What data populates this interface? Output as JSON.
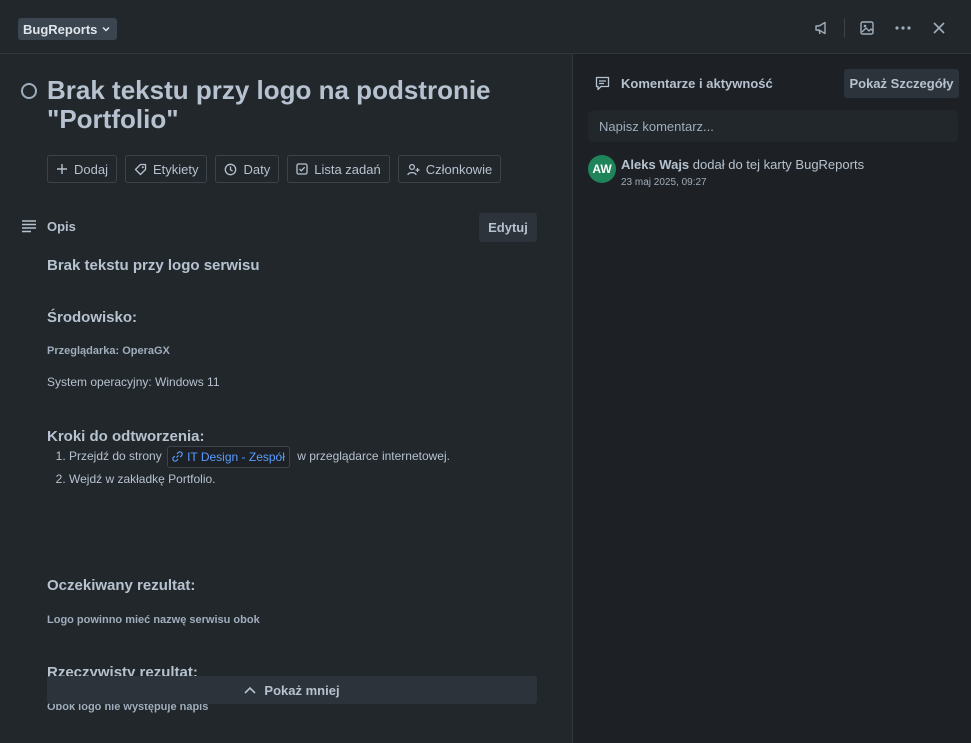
{
  "header": {
    "list_name": "BugReports",
    "icons": [
      "megaphone-icon",
      "image-icon",
      "more-icon",
      "close-icon"
    ]
  },
  "card": {
    "title": "Brak tekstu przy logo na podstronie \"Portfolio\"",
    "actions": [
      {
        "label": "Dodaj",
        "icon": "plus-icon"
      },
      {
        "label": "Etykiety",
        "icon": "tag-icon"
      },
      {
        "label": "Daty",
        "icon": "clock-icon"
      },
      {
        "label": "Lista zadań",
        "icon": "checklist-icon"
      },
      {
        "label": "Członkowie",
        "icon": "add-member-icon"
      }
    ]
  },
  "description": {
    "label": "Opis",
    "edit_label": "Edytuj",
    "heading": "Brak tekstu przy logo serwisu",
    "env_heading": "Środowisko:",
    "browser": "Przeglądarka: OperaGX",
    "os": "System operacyjny: Windows 11",
    "steps_heading": "Kroki do odtworzenia:",
    "step1_prefix": "Przejdź do strony",
    "step1_link": "IT Design - Zespół",
    "step1_suffix": "w przeglądarce internetowej.",
    "step2": "Wejdź w zakładkę Portfolio.",
    "expected_heading": "Oczekiwany rezultat:",
    "expected": "Logo powinno mieć nazwę serwisu obok",
    "actual_heading": "Rzeczywisty rezultat:",
    "actual": "Obok logo nie występuje napis",
    "show_less": "Pokaż mniej"
  },
  "activity": {
    "title": "Komentarze i aktywność",
    "details_button": "Pokaż Szczegóły",
    "comment_placeholder": "Napisz komentarz...",
    "items": [
      {
        "initials": "AW",
        "user": "Aleks Wajs",
        "action": "dodał do tej karty BugReports",
        "time": "23 maj 2025, 09:27",
        "avatar_color": "#1f845a"
      }
    ]
  },
  "colors": {
    "background": "#1d2125",
    "panel": "#22272b",
    "button": "#2c333a",
    "text": "#b6c2cf",
    "link": "#579dff"
  }
}
